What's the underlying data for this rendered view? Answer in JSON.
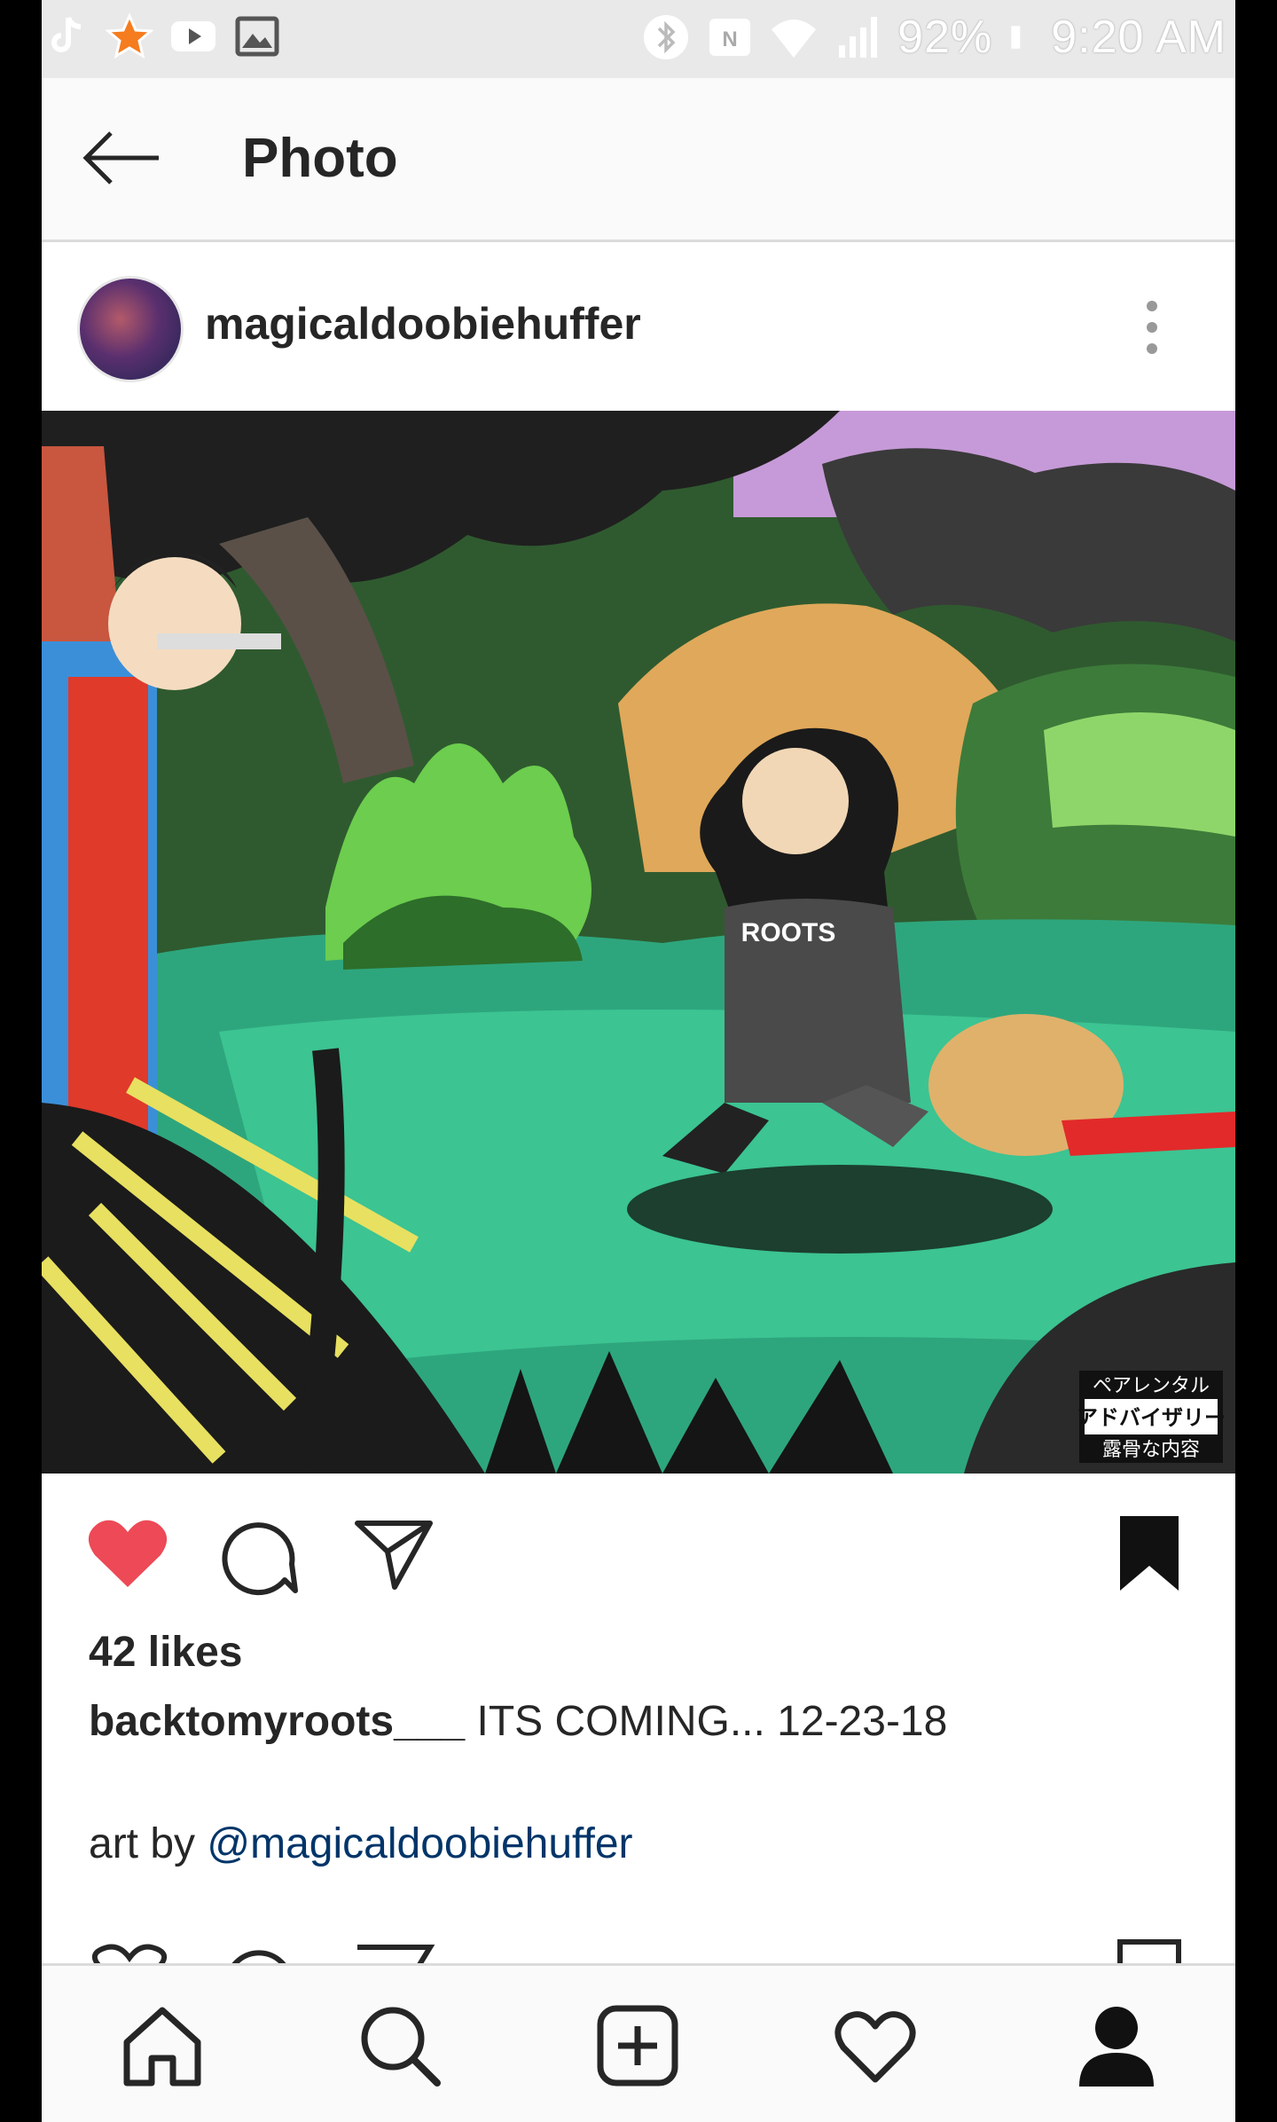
{
  "status_bar": {
    "battery": "92%",
    "time": "9:20 AM"
  },
  "header": {
    "title": "Photo"
  },
  "post": {
    "username": "magicaldoobiehuffer",
    "photo_advisory_text": [
      "ペアレンタル",
      "アドバイザリー",
      "露骨な内容"
    ],
    "shirt_text": "ROOTS",
    "liked": true,
    "saved": true,
    "likes_text": "42 likes",
    "caption_user": "backtomyroots___",
    "caption_text": " ITS COMING... 12-23-18",
    "credit_prefix": "art by ",
    "credit_mention": "@magicaldoobiehuffer"
  },
  "colors": {
    "like_red": "#ed4956",
    "text": "#262626",
    "mention_blue": "#003569",
    "divider": "#dbdbdb"
  },
  "icons": {
    "status_left": [
      "tiktok-icon",
      "star-icon",
      "youtube-icon",
      "image-icon"
    ],
    "status_right": [
      "bluetooth-icon",
      "nfc-icon",
      "wifi-icon",
      "signal-icon",
      "battery-icon"
    ],
    "actions": [
      "heart-icon",
      "comment-icon",
      "share-icon",
      "bookmark-icon"
    ],
    "bottom_nav": [
      "home-icon",
      "search-icon",
      "new-post-icon",
      "activity-heart-icon",
      "profile-icon"
    ]
  }
}
